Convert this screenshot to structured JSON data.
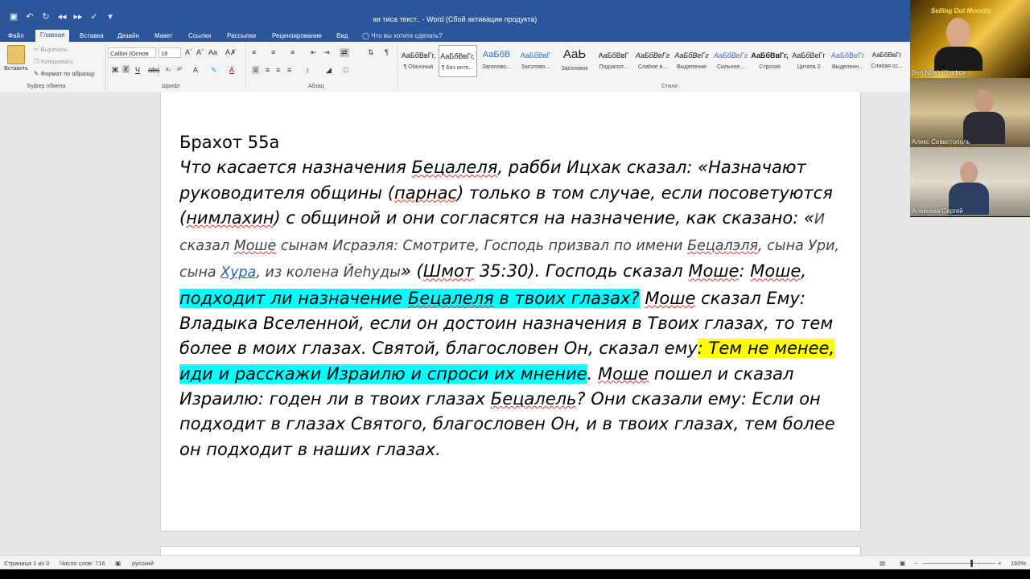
{
  "titlebar": {
    "title": "ки тиса текст.. - Word (Сбой активации продукта)",
    "qat_icons": [
      "save-icon",
      "undo-icon",
      "redo-icon",
      "back-icon",
      "forward-icon",
      "spelling-icon",
      "customize-icon"
    ]
  },
  "tabs": {
    "items": [
      "Файл",
      "Главная",
      "Вставка",
      "Дизайн",
      "Макет",
      "Ссылки",
      "Рассылки",
      "Рецензирование",
      "Вид"
    ],
    "active": "Главная",
    "tell_me": "Что вы хотите сделать?"
  },
  "ribbon": {
    "clipboard": {
      "paste": "Вставить",
      "cut": "Вырезать",
      "copy": "Копировать",
      "format_painter": "Формат по образцу",
      "group": "Буфер обмена"
    },
    "font": {
      "name": "Calibri (Основ",
      "size": "18",
      "group": "Шрифт"
    },
    "paragraph": {
      "group": "Абзац"
    },
    "styles": {
      "group": "Стили",
      "items": [
        {
          "sample": "АаБбВвГг,",
          "name": "¶ Обычный"
        },
        {
          "sample": "АаБбВвГг,",
          "name": "¶ Без инте..."
        },
        {
          "sample": "АаБбВ",
          "name": "Заголово..."
        },
        {
          "sample": "АаБбВвГ",
          "name": "Заголово..."
        },
        {
          "sample": "АаЬ",
          "name": "Заголовок"
        },
        {
          "sample": "АаБбВвГ",
          "name": "Подзагол..."
        },
        {
          "sample": "АаБбВеГг",
          "name": "Слабое в..."
        },
        {
          "sample": "АаБбВеГг",
          "name": "Выделение"
        },
        {
          "sample": "АаБбВеГг",
          "name": "Сильное..."
        },
        {
          "sample": "АаБбВвГг,",
          "name": "Строгий"
        },
        {
          "sample": "АаБбВеГг",
          "name": "Цитата 2"
        },
        {
          "sample": "АаБбВеГг",
          "name": "Выделенн..."
        },
        {
          "sample": "АаБбВвГг",
          "name": "Слабая сс..."
        }
      ]
    }
  },
  "document": {
    "heading": "Брахот 55а",
    "p1a": "Что касается назначения ",
    "w_betsalel": "Бецалеля",
    "p1b": ", рабби Ицхак сказал: «Назначают руководителя общины (",
    "w_parnas": "парнас",
    "p1c": ") только в том случае, если посоветуются (",
    "w_nimlakhin": "нимлахин",
    "p1d": ") с общиной и они согласятся на назначение, как сказано: «",
    "q1": "И сказал ",
    "w_moshe1": "Моше",
    "q2": " сынам Исраэля: Смотрите, Господь призвал по имени ",
    "w_betsalel2": "Бецалэля",
    "q3": ", сына Ури, сына ",
    "w_khura": "Хура",
    "q4": ", из колена Йеhуды",
    "p2a": "» (",
    "w_shmot": "Шмот",
    "p2b": " 35:30). Господь сказал ",
    "w_moshe2": "Моше",
    "p2c": ": ",
    "w_moshe3": "Моше",
    "p2d": ", ",
    "hl1a": "подходит ли назначение ",
    "w_betsalel3": "Бецалеля",
    "hl1b": " в твоих глазах?",
    "p3a": " ",
    "w_moshe4": "Моше",
    "p3b": " сказал Ему: Владыка Вселенной, если он достоин назначения в Твоих глазах, то тем более в моих глазах. Святой, благословен Он, сказал ему",
    "hl2": ": Тем не менее,",
    "p4a": " ",
    "hl3": "иди и расскажи Израилю и спроси их мнение",
    "p5a": ". ",
    "w_moshe5": "Моше",
    "p5b": " пошел и сказал Израилю: годен ли в твоих глазах ",
    "w_betsalel4": "Бецалель",
    "p5c": "? Они сказали ему: Если он подходит в глазах Святого, благословен Он, и в твоих глазах, тем более он подходит в наших глазах."
  },
  "video": {
    "tiles": [
      {
        "name": "Ben Noah Kharkov",
        "banner": "Selling Out Morality"
      },
      {
        "name": "Алекс Севастополь"
      },
      {
        "name": "Алексеев Сергей"
      }
    ]
  },
  "statusbar": {
    "page": "Страница 1 из 3",
    "words": "Число слов: 716",
    "language": "русский",
    "zoom": "160%",
    "zoom_fraction": 0.67
  }
}
